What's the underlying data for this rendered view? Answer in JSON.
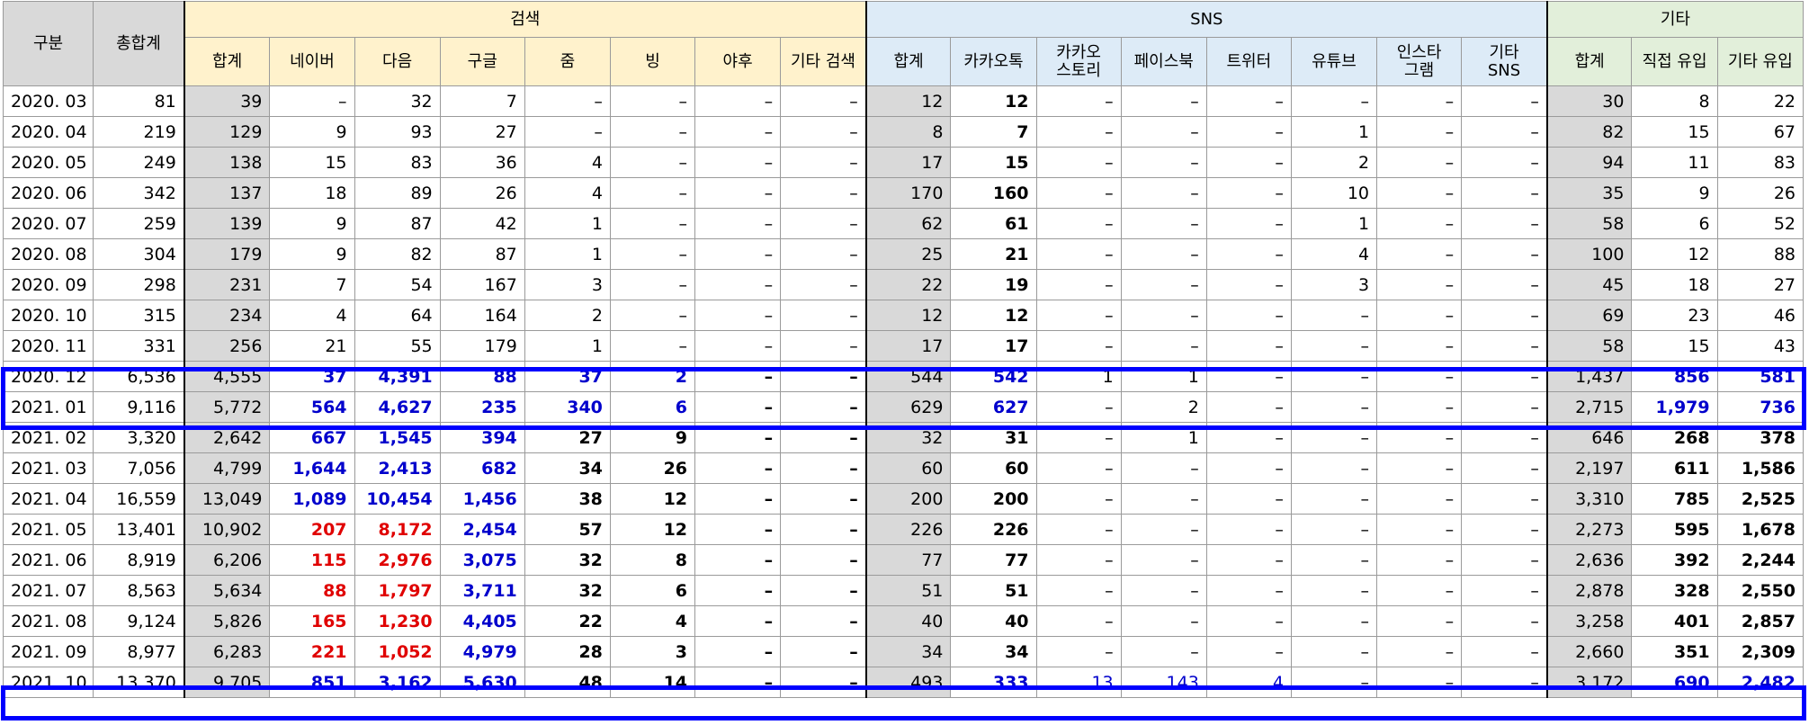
{
  "headers": {
    "gubun": "구분",
    "total": "총합계",
    "group_search": "검색",
    "group_sns": "SNS",
    "group_etc": "기타",
    "search_cols": [
      "합계",
      "네이버",
      "다음",
      "구글",
      "줌",
      "빙",
      "야후",
      "기타 검색"
    ],
    "sns_cols": [
      "합계",
      "카카오톡",
      "카카오\n스토리",
      "페이스북",
      "트위터",
      "유튜브",
      "인스타\n그램",
      "기타\nSNS"
    ],
    "etc_cols": [
      "합계",
      "직접 유입",
      "기타 유입"
    ]
  },
  "rows": [
    {
      "label": "2020. 03",
      "total": "81",
      "search": [
        "39",
        "–",
        "32",
        "7",
        "–",
        "–",
        "–",
        "–"
      ],
      "sns": [
        "12",
        "12",
        "–",
        "–",
        "–",
        "–",
        "–",
        "–"
      ],
      "etc": [
        "30",
        "8",
        "22"
      ]
    },
    {
      "label": "2020. 04",
      "total": "219",
      "search": [
        "129",
        "9",
        "93",
        "27",
        "–",
        "–",
        "–",
        "–"
      ],
      "sns": [
        "8",
        "7",
        "–",
        "–",
        "–",
        "1",
        "–",
        "–"
      ],
      "etc": [
        "82",
        "15",
        "67"
      ]
    },
    {
      "label": "2020. 05",
      "total": "249",
      "search": [
        "138",
        "15",
        "83",
        "36",
        "4",
        "–",
        "–",
        "–"
      ],
      "sns": [
        "17",
        "15",
        "–",
        "–",
        "–",
        "2",
        "–",
        "–"
      ],
      "etc": [
        "94",
        "11",
        "83"
      ]
    },
    {
      "label": "2020. 06",
      "total": "342",
      "search": [
        "137",
        "18",
        "89",
        "26",
        "4",
        "–",
        "–",
        "–"
      ],
      "sns": [
        "170",
        "160",
        "–",
        "–",
        "–",
        "10",
        "–",
        "–"
      ],
      "etc": [
        "35",
        "9",
        "26"
      ]
    },
    {
      "label": "2020. 07",
      "total": "259",
      "search": [
        "139",
        "9",
        "87",
        "42",
        "1",
        "–",
        "–",
        "–"
      ],
      "sns": [
        "62",
        "61",
        "–",
        "–",
        "–",
        "1",
        "–",
        "–"
      ],
      "etc": [
        "58",
        "6",
        "52"
      ]
    },
    {
      "label": "2020. 08",
      "total": "304",
      "search": [
        "179",
        "9",
        "82",
        "87",
        "1",
        "–",
        "–",
        "–"
      ],
      "sns": [
        "25",
        "21",
        "–",
        "–",
        "–",
        "4",
        "–",
        "–"
      ],
      "etc": [
        "100",
        "12",
        "88"
      ]
    },
    {
      "label": "2020. 09",
      "total": "298",
      "search": [
        "231",
        "7",
        "54",
        "167",
        "3",
        "–",
        "–",
        "–"
      ],
      "sns": [
        "22",
        "19",
        "–",
        "–",
        "–",
        "3",
        "–",
        "–"
      ],
      "etc": [
        "45",
        "18",
        "27"
      ]
    },
    {
      "label": "2020. 10",
      "total": "315",
      "search": [
        "234",
        "4",
        "64",
        "164",
        "2",
        "–",
        "–",
        "–"
      ],
      "sns": [
        "12",
        "12",
        "–",
        "–",
        "–",
        "–",
        "–",
        "–"
      ],
      "etc": [
        "69",
        "23",
        "46"
      ]
    },
    {
      "label": "2020. 11",
      "total": "331",
      "search": [
        "256",
        "21",
        "55",
        "179",
        "1",
        "–",
        "–",
        "–"
      ],
      "sns": [
        "17",
        "17",
        "–",
        "–",
        "–",
        "–",
        "–",
        "–"
      ],
      "etc": [
        "58",
        "15",
        "43"
      ]
    },
    {
      "label": "2020. 12",
      "total": "6,536",
      "search": [
        "4,555",
        "37",
        "4,391",
        "88",
        "37",
        "2",
        "–",
        "–"
      ],
      "sns": [
        "544",
        "542",
        "1",
        "1",
        "–",
        "–",
        "–",
        "–"
      ],
      "etc": [
        "1,437",
        "856",
        "581"
      ]
    },
    {
      "label": "2021. 01",
      "total": "9,116",
      "search": [
        "5,772",
        "564",
        "4,627",
        "235",
        "340",
        "6",
        "–",
        "–"
      ],
      "sns": [
        "629",
        "627",
        "–",
        "2",
        "–",
        "–",
        "–",
        "–"
      ],
      "etc": [
        "2,715",
        "1,979",
        "736"
      ]
    },
    {
      "label": "2021. 02",
      "total": "3,320",
      "search": [
        "2,642",
        "667",
        "1,545",
        "394",
        "27",
        "9",
        "–",
        "–"
      ],
      "sns": [
        "32",
        "31",
        "–",
        "1",
        "–",
        "–",
        "–",
        "–"
      ],
      "etc": [
        "646",
        "268",
        "378"
      ]
    },
    {
      "label": "2021. 03",
      "total": "7,056",
      "search": [
        "4,799",
        "1,644",
        "2,413",
        "682",
        "34",
        "26",
        "–",
        "–"
      ],
      "sns": [
        "60",
        "60",
        "–",
        "–",
        "–",
        "–",
        "–",
        "–"
      ],
      "etc": [
        "2,197",
        "611",
        "1,586"
      ]
    },
    {
      "label": "2021. 04",
      "total": "16,559",
      "search": [
        "13,049",
        "1,089",
        "10,454",
        "1,456",
        "38",
        "12",
        "–",
        "–"
      ],
      "sns": [
        "200",
        "200",
        "–",
        "–",
        "–",
        "–",
        "–",
        "–"
      ],
      "etc": [
        "3,310",
        "785",
        "2,525"
      ]
    },
    {
      "label": "2021. 05",
      "total": "13,401",
      "search": [
        "10,902",
        "207",
        "8,172",
        "2,454",
        "57",
        "12",
        "–",
        "–"
      ],
      "sns": [
        "226",
        "226",
        "–",
        "–",
        "–",
        "–",
        "–",
        "–"
      ],
      "etc": [
        "2,273",
        "595",
        "1,678"
      ]
    },
    {
      "label": "2021. 06",
      "total": "8,919",
      "search": [
        "6,206",
        "115",
        "2,976",
        "3,075",
        "32",
        "8",
        "–",
        "–"
      ],
      "sns": [
        "77",
        "77",
        "–",
        "–",
        "–",
        "–",
        "–",
        "–"
      ],
      "etc": [
        "2,636",
        "392",
        "2,244"
      ]
    },
    {
      "label": "2021. 07",
      "total": "8,563",
      "search": [
        "5,634",
        "88",
        "1,797",
        "3,711",
        "32",
        "6",
        "–",
        "–"
      ],
      "sns": [
        "51",
        "51",
        "–",
        "–",
        "–",
        "–",
        "–",
        "–"
      ],
      "etc": [
        "2,878",
        "328",
        "2,550"
      ]
    },
    {
      "label": "2021. 08",
      "total": "9,124",
      "search": [
        "5,826",
        "165",
        "1,230",
        "4,405",
        "22",
        "4",
        "–",
        "–"
      ],
      "sns": [
        "40",
        "40",
        "–",
        "–",
        "–",
        "–",
        "–",
        "–"
      ],
      "etc": [
        "3,258",
        "401",
        "2,857"
      ]
    },
    {
      "label": "2021. 09",
      "total": "8,977",
      "search": [
        "6,283",
        "221",
        "1,052",
        "4,979",
        "28",
        "3",
        "–",
        "–"
      ],
      "sns": [
        "34",
        "34",
        "–",
        "–",
        "–",
        "–",
        "–",
        "–"
      ],
      "etc": [
        "2,660",
        "351",
        "2,309"
      ]
    },
    {
      "label": "2021. 10",
      "total": "13,370",
      "search": [
        "9,705",
        "851",
        "3,162",
        "5,630",
        "48",
        "14",
        "–",
        "–"
      ],
      "sns": [
        "493",
        "333",
        "13",
        "143",
        "4",
        "–",
        "–",
        "–"
      ],
      "etc": [
        "3,172",
        "690",
        "2,482"
      ]
    }
  ],
  "colors": {
    "blue_text": "#0000cc",
    "red_text": "#e00000",
    "highlight_box": "#0000ff",
    "search_header_bg": "#fff2cc",
    "sns_header_bg": "#ddebf7",
    "etc_header_bg": "#e2efda",
    "sum_column_bg": "#d9d9d9"
  }
}
